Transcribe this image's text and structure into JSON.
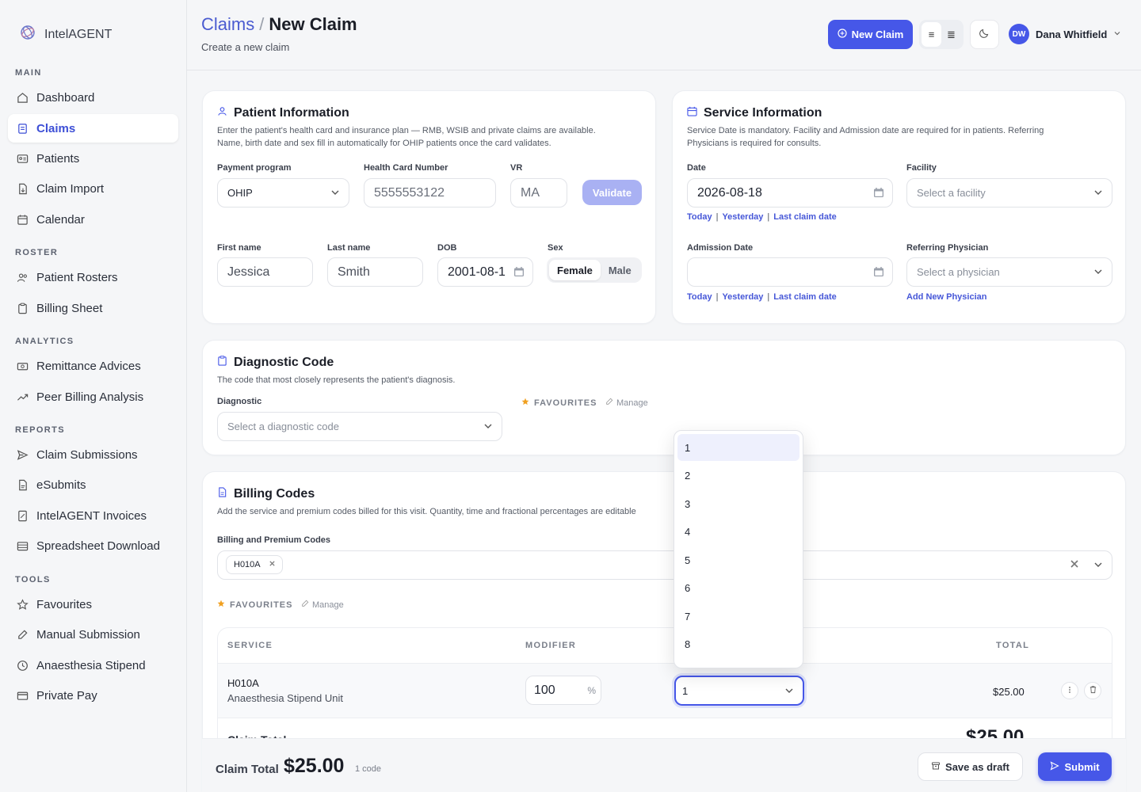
{
  "brand": {
    "name": "IntelAGENT"
  },
  "sidebar": {
    "sections": [
      {
        "label": "MAIN",
        "items": [
          {
            "label": "Dashboard",
            "icon": "home-icon"
          },
          {
            "label": "Claims",
            "icon": "claims-icon",
            "active": true
          },
          {
            "label": "Patients",
            "icon": "id-card-icon"
          },
          {
            "label": "Claim Import",
            "icon": "file-import-icon"
          },
          {
            "label": "Calendar",
            "icon": "calendar-icon"
          }
        ]
      },
      {
        "label": "ROSTER",
        "items": [
          {
            "label": "Patient Rosters",
            "icon": "users-icon"
          },
          {
            "label": "Billing Sheet",
            "icon": "clipboard-icon"
          }
        ]
      },
      {
        "label": "ANALYTICS",
        "items": [
          {
            "label": "Remittance Advices",
            "icon": "money-icon"
          },
          {
            "label": "Peer Billing Analysis",
            "icon": "trend-icon"
          }
        ]
      },
      {
        "label": "REPORTS",
        "items": [
          {
            "label": "Claim Submissions",
            "icon": "send-icon"
          },
          {
            "label": "eSubmits",
            "icon": "file-icon"
          },
          {
            "label": "IntelAGENT Invoices",
            "icon": "invoice-icon"
          },
          {
            "label": "Spreadsheet Download",
            "icon": "table-icon"
          }
        ]
      },
      {
        "label": "TOOLS",
        "items": [
          {
            "label": "Favourites",
            "icon": "star-icon"
          },
          {
            "label": "Manual Submission",
            "icon": "edit-icon"
          },
          {
            "label": "Anaesthesia Stipend",
            "icon": "clock-icon"
          },
          {
            "label": "Private Pay",
            "icon": "card-icon"
          }
        ]
      }
    ]
  },
  "header": {
    "breadcrumb_parent": "Claims",
    "breadcrumb_sep": "/",
    "title": "New Claim",
    "subtitle": "Create a new claim",
    "new_claim_label": "New Claim",
    "user_initials": "DW",
    "user_name": "Dana Whitfield"
  },
  "patient": {
    "title": "Patient Information",
    "desc_line1": "Enter the patient's health card and insurance plan — RMB, WSIB and private claims are available.",
    "desc_line2": "Name, birth date and sex fill in automatically for OHIP patients once the card validates.",
    "payment_label": "Payment program",
    "payment_value": "OHIP",
    "hcn_label": "Health Card Number",
    "hcn_value": "5555553122",
    "vr_label": "VR",
    "vr_value": "MA",
    "validate_label": "Validate",
    "first_label": "First name",
    "first_value": "Jessica",
    "last_label": "Last name",
    "last_value": "Smith",
    "dob_label": "DOB",
    "dob_value": "2001-08-1",
    "sex_label": "Sex",
    "sex_female": "Female",
    "sex_male": "Male"
  },
  "service": {
    "title": "Service Information",
    "desc_line1": "Service Date is mandatory. Facility and Admission date are required for in patients. Referring",
    "desc_line2": "Physicians is required for consults.",
    "date_label": "Date",
    "date_value": "2026-08-18",
    "quick_today": "Today",
    "quick_yesterday": "Yesterday",
    "quick_last": "Last claim date",
    "quick_sep": "|",
    "facility_label": "Facility",
    "facility_placeholder": "Select a facility",
    "admission_label": "Admission Date",
    "admission_value": "",
    "referring_label": "Referring Physician",
    "referring_placeholder": "Select a physician",
    "add_physician": "Add New Physician"
  },
  "diagnostic": {
    "title": "Diagnostic Code",
    "desc": "The code that most closely represents the patient's diagnosis.",
    "label": "Diagnostic",
    "placeholder": "Select a diagnostic code",
    "favourites": "FAVOURITES",
    "manage": "Manage"
  },
  "billing": {
    "title": "Billing Codes",
    "desc": "Add the service and premium codes billed for this visit. Quantity, time and fractional percentages are editable",
    "codes_label": "Billing and Premium Codes",
    "chip": "H010A",
    "favourites": "FAVOURITES",
    "manage": "Manage",
    "col_service": "SERVICE",
    "col_modifier": "MODIFIER",
    "col_total": "TOTAL",
    "row": {
      "code": "H010A",
      "desc": "Anaesthesia Stipend Unit",
      "modifier": "100",
      "modifier_unit": "%",
      "unit_selected": "1",
      "total": "$25.00"
    },
    "claim_total_label": "Claim Total",
    "claim_total_value": "$25.00"
  },
  "dropdown": {
    "options": [
      "1",
      "2",
      "3",
      "4",
      "5",
      "6",
      "7",
      "8"
    ],
    "highlighted": "1"
  },
  "footer": {
    "label": "Claim Total",
    "amount": "$25.00",
    "count": "1 code",
    "draft_label": "Save as draft",
    "submit_label": "Submit"
  },
  "colors": {
    "accent": "#4657e8",
    "accent_text": "#3d4fd6",
    "validate_disabled": "#a9b1f3",
    "favourite_star": "#f0a020"
  }
}
